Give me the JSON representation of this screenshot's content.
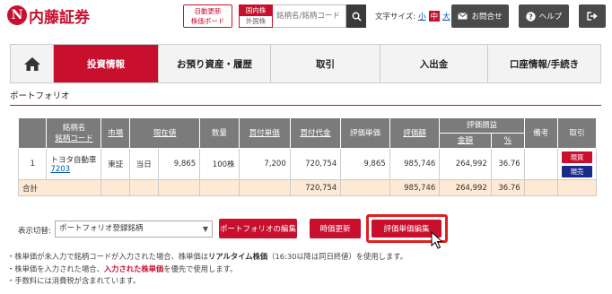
{
  "header": {
    "logo_mark": "N",
    "logo_text": "内藤証券",
    "auto_update_line1": "自動更新",
    "auto_update_line2": "株価ボード",
    "market_domestic": "国内株",
    "market_foreign": "外国株",
    "search_placeholder": "銘柄名/銘柄コード",
    "font_size_label": "文字サイズ:",
    "font_small": "小",
    "font_medium": "中",
    "font_large": "大",
    "contact_label": "お問合せ",
    "help_label": "ヘルプ"
  },
  "nav": {
    "tabs": [
      {
        "label": "投資情報",
        "active": true
      },
      {
        "label": "お預り資産・履歴",
        "active": false
      },
      {
        "label": "取引",
        "active": false
      },
      {
        "label": "入出金",
        "active": false
      },
      {
        "label": "口座情報/手続き",
        "active": false
      }
    ]
  },
  "section": {
    "title": "ポートフォリオ"
  },
  "table": {
    "headers": {
      "name_line1": "銘柄名",
      "name_line2": "銘柄コード",
      "market": "市場",
      "price": "現在値",
      "quantity": "数量",
      "buy_unit": "買付単価",
      "buy_amount": "買付代金",
      "eval_unit": "評価単価",
      "eval_amount": "評価額",
      "pl_group": "評価損益",
      "pl_amount": "金額",
      "pl_pct": "%",
      "memo": "備考",
      "trade": "取引"
    },
    "rows": [
      {
        "no": "1",
        "name": "トヨタ自動車",
        "code": "7203",
        "market": "東証",
        "day": "当日",
        "price": "9,865",
        "quantity": "100株",
        "buy_unit": "7,200",
        "buy_amount": "720,754",
        "eval_unit": "9,865",
        "eval_amount": "985,746",
        "pl_amount": "264,992",
        "pl_pct": "36.76",
        "memo": "",
        "buy_btn": "現買",
        "sell_btn": "現売"
      }
    ],
    "total": {
      "label": "合計",
      "buy_amount": "720,754",
      "eval_amount": "985,746",
      "pl_amount": "264,992",
      "pl_pct": "36.76"
    }
  },
  "controls": {
    "view_label": "表示切替:",
    "view_selected": "ポートフォリオ登録銘柄",
    "edit_btn": "ポートフォリオの編集",
    "refresh_btn": "時価更新",
    "value_edit_btn": "評価単価編集"
  },
  "notes": {
    "n1_a": "・株単価が未入力で銘柄コードが入力された場合、株単価は",
    "n1_b": "リアルタイム株価",
    "n1_c": "（16:30以降は同日終値）を使用します。",
    "n2_a": "・株単価を入力された場合、",
    "n2_b": "入力された株単価",
    "n2_c": "を優先で使用します。",
    "n3": "・手数料には消費税が含まれています。"
  },
  "colors": {
    "brand_red": "#c8102e",
    "sell_blue": "#1b2a8a",
    "header_gray": "#7b7b7b",
    "total_row": "#fde9d4"
  }
}
